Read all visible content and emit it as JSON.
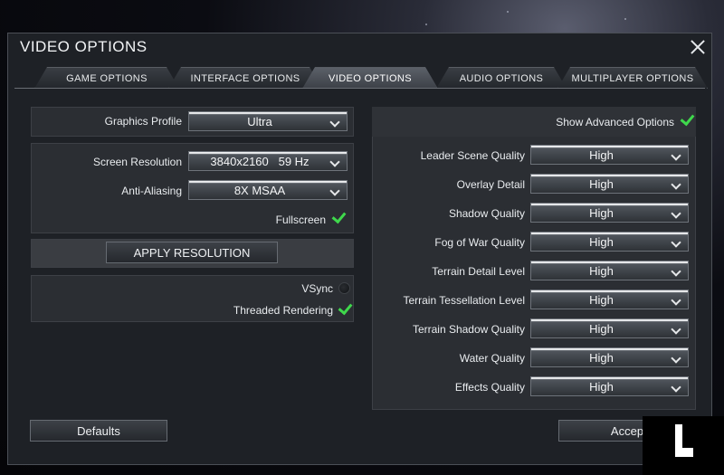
{
  "dialog": {
    "title": "VIDEO OPTIONS"
  },
  "tabs": [
    {
      "label": "GAME OPTIONS",
      "active": false
    },
    {
      "label": "INTERFACE OPTIONS",
      "active": false
    },
    {
      "label": "VIDEO OPTIONS",
      "active": true
    },
    {
      "label": "AUDIO OPTIONS",
      "active": false
    },
    {
      "label": "MULTIPLAYER OPTIONS",
      "active": false
    }
  ],
  "left": {
    "graphics_profile": {
      "label": "Graphics Profile",
      "value": "Ultra"
    },
    "screen_resolution": {
      "label": "Screen Resolution",
      "value": "3840x2160   59 Hz"
    },
    "anti_aliasing": {
      "label": "Anti-Aliasing",
      "value": "8X MSAA"
    },
    "fullscreen": {
      "label": "Fullscreen",
      "checked": true
    },
    "apply_button": "APPLY RESOLUTION",
    "vsync": {
      "label": "VSync",
      "checked": false
    },
    "threaded_rendering": {
      "label": "Threaded Rendering",
      "checked": true
    }
  },
  "advanced": {
    "show_label": "Show Advanced Options",
    "show_checked": true,
    "settings": [
      {
        "label": "Leader Scene Quality",
        "value": "High"
      },
      {
        "label": "Overlay Detail",
        "value": "High"
      },
      {
        "label": "Shadow Quality",
        "value": "High"
      },
      {
        "label": "Fog of War Quality",
        "value": "High"
      },
      {
        "label": "Terrain Detail Level",
        "value": "High"
      },
      {
        "label": "Terrain Tessellation Level",
        "value": "High"
      },
      {
        "label": "Terrain Shadow Quality",
        "value": "High"
      },
      {
        "label": "Water Quality",
        "value": "High"
      },
      {
        "label": "Effects Quality",
        "value": "High"
      }
    ]
  },
  "footer": {
    "defaults_button": "Defaults",
    "accept_button": "Accep"
  },
  "colors": {
    "check": "#3fd84c",
    "panel": "#1e2126",
    "box": "#2b2e33"
  }
}
